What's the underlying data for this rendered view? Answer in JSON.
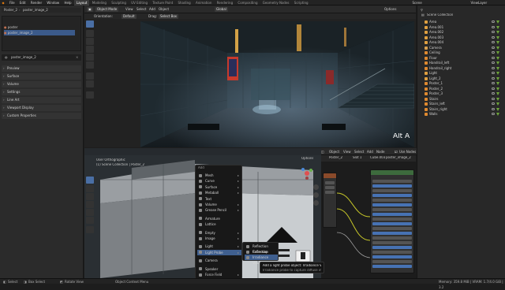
{
  "menubar": {
    "items": [
      "File",
      "Edit",
      "Render",
      "Window",
      "Help"
    ],
    "workspaces": [
      "Layout",
      "Modeling",
      "Sculpting",
      "UV Editing",
      "Texture Paint",
      "Shading",
      "Animation",
      "Rendering",
      "Compositing",
      "Geometry Nodes",
      "Scripting"
    ],
    "active_workspace": "Layout",
    "scene_label": "Scene",
    "view_layer_label": "ViewLayer"
  },
  "properties": {
    "breadcrumb_object": "Poster_2",
    "breadcrumb_data": "poster_image_2",
    "tree_root": "poster",
    "tree_child": "poster_image_2",
    "name_field": "poster_image_2",
    "sections": [
      "Preview",
      "Surface",
      "Volume",
      "Settings",
      "Line Art",
      "Viewport Display",
      "Custom Properties"
    ]
  },
  "viewport_top": {
    "orientation_label": "Orientation:",
    "orientation_value": "Default",
    "drag_label": "Drag:",
    "drag_value": "Select Box",
    "mode": "Object Mode",
    "menus": [
      "View",
      "Select",
      "Add",
      "Object"
    ],
    "transform": "Global",
    "options_label": "Options",
    "overlay_text": "Alt A"
  },
  "viewport_bottom": {
    "mode": "Object Mode",
    "menus": [
      "View",
      "Select",
      "Add",
      "Object"
    ],
    "transform": "Global",
    "drag_value": "Select Box",
    "view_name": "User Orthographic",
    "collection_path": "(1) Scene Collection | Poster_2",
    "options_label": "Options"
  },
  "node_editor": {
    "header_items": [
      "Object",
      "View",
      "Select",
      "Add",
      "Node"
    ],
    "use_nodes_label": "Use Nodes",
    "object_name": "Poster_2",
    "cube_name": "Cube.003",
    "material_name": "poster_image_2",
    "slot_label": "Slot 1"
  },
  "add_menu": {
    "title": "Add",
    "items": [
      {
        "label": "Mesh",
        "icon": "mesh-icon",
        "submenu": true
      },
      {
        "label": "Curve",
        "icon": "curve-icon",
        "submenu": true
      },
      {
        "label": "Surface",
        "icon": "surface-icon",
        "submenu": true
      },
      {
        "label": "Metaball",
        "icon": "metaball-icon",
        "submenu": true
      },
      {
        "label": "Text",
        "icon": "text-icon",
        "submenu": false
      },
      {
        "label": "Volume",
        "icon": "volume-icon",
        "submenu": true
      },
      {
        "label": "Grease Pencil",
        "icon": "grease-pencil-icon",
        "submenu": true
      },
      {
        "label": "Armature",
        "icon": "armature-icon",
        "submenu": false
      },
      {
        "label": "Lattice",
        "icon": "lattice-icon",
        "submenu": false
      },
      {
        "label": "Empty",
        "icon": "empty-icon",
        "submenu": true
      },
      {
        "label": "Image",
        "icon": "image-icon",
        "submenu": true
      },
      {
        "label": "Light",
        "icon": "light-icon",
        "submenu": true
      },
      {
        "label": "Light Probe",
        "icon": "light-probe-icon",
        "submenu": true,
        "highlighted": true
      },
      {
        "label": "Camera",
        "icon": "camera-icon",
        "submenu": false
      },
      {
        "label": "Speaker",
        "icon": "speaker-icon",
        "submenu": false
      },
      {
        "label": "Force Field",
        "icon": "force-field-icon",
        "submenu": true
      },
      {
        "label": "Collection Instance",
        "icon": "collection-icon",
        "submenu": true
      }
    ]
  },
  "light_probe_menu": {
    "items": [
      "Reflection Cubemap",
      "Reflection Plane",
      "Irradiance Volume"
    ],
    "highlighted_index": 2
  },
  "tooltip": {
    "title": "Add a light probe object:  Irradiance Volume",
    "body": "Irradiance probe to capture diffuse indirect lighting"
  },
  "outliner": {
    "title": "Scene Collection",
    "items": [
      {
        "name": "Area",
        "color": "#e0a040"
      },
      {
        "name": "Area.001",
        "color": "#e0a040"
      },
      {
        "name": "Area.002",
        "color": "#e0a040"
      },
      {
        "name": "Area.003",
        "color": "#e0a040"
      },
      {
        "name": "Area.004",
        "color": "#e0a040"
      },
      {
        "name": "Camera",
        "color": "#d8a050"
      },
      {
        "name": "Ceiling",
        "color": "#e08a30"
      },
      {
        "name": "Floor",
        "color": "#e08a30"
      },
      {
        "name": "Handrail_left",
        "color": "#e08a30"
      },
      {
        "name": "Handrail_right",
        "color": "#e08a30"
      },
      {
        "name": "Light",
        "color": "#e0a040"
      },
      {
        "name": "Light_2",
        "color": "#e0a040"
      },
      {
        "name": "Poster_1",
        "color": "#e08a30"
      },
      {
        "name": "Poster_2",
        "color": "#e08a30"
      },
      {
        "name": "Poster_3",
        "color": "#e08a30"
      },
      {
        "name": "Stairs",
        "color": "#e08a30"
      },
      {
        "name": "Stairs_left",
        "color": "#e08a30"
      },
      {
        "name": "Stairs_right",
        "color": "#e08a30"
      },
      {
        "name": "Walls",
        "color": "#e08a30"
      }
    ]
  },
  "statusbar": {
    "left_items": [
      "Select",
      "Box Select",
      "Rotate View"
    ],
    "middle": "Object Context Menu",
    "right": "Memory: 359.8 MiB | VRAM: 1.7/4.0 GiB | 3.2"
  },
  "colors": {
    "accent": "#4772b3",
    "highlight": "#3f5f8f",
    "object_orange": "#e08a30",
    "render_red": "#c73a2c"
  }
}
